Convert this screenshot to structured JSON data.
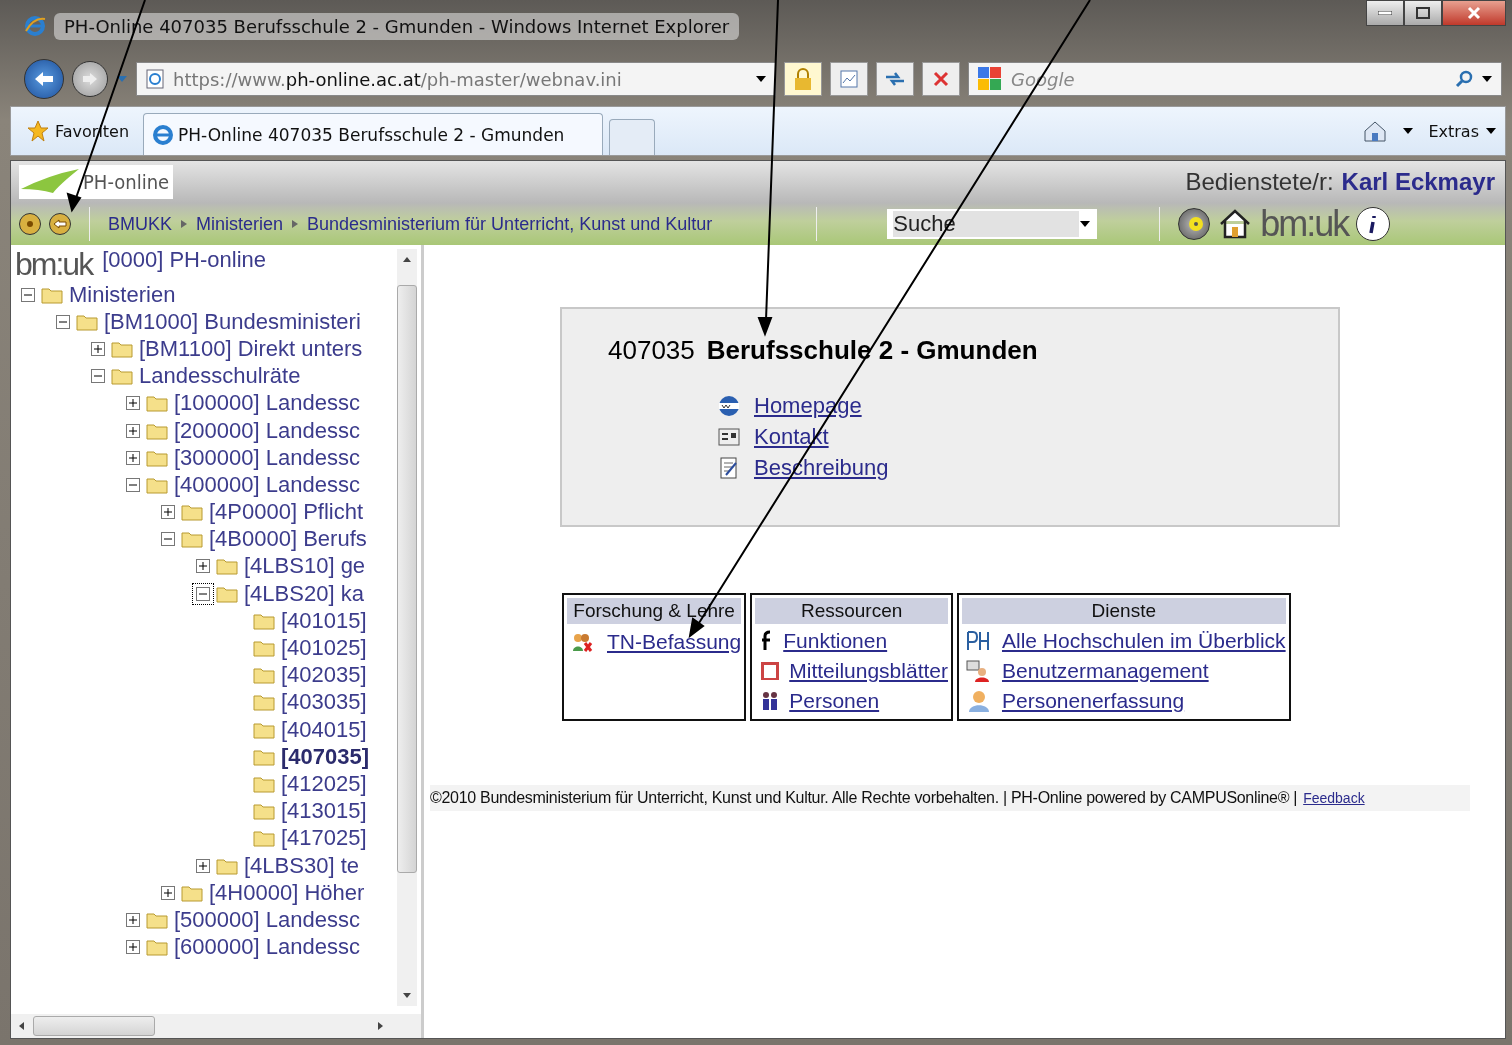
{
  "window": {
    "title": "PH-Online 407035 Berufsschule 2 - Gmunden - Windows Internet Explorer"
  },
  "address_bar": {
    "url_prefix": "https://www.",
    "url_domain": "ph-online.ac.at",
    "url_path": "/ph-master/webnav.ini",
    "search_placeholder": "Google"
  },
  "favorites": "Favoriten",
  "tabs": [
    {
      "label": "PH-Online 407035 Berufsschule 2 - Gmunden",
      "selected": true
    }
  ],
  "command_bar": {
    "extras": "Extras"
  },
  "header": {
    "logo": "PH-online",
    "user_label": "Bedienstete/r:",
    "user_name": "Karl Eckmayr",
    "breadcrumbs": [
      "BMUKK",
      "Ministerien",
      "Bundesministerium für Unterricht, Kunst und Kultur"
    ],
    "search_select": "Suche",
    "brand": "bm:uk"
  },
  "tree": {
    "logo": "bm:uk",
    "root": "[0000] PH-online",
    "items": [
      {
        "label": "Ministerien",
        "expanded": true,
        "children": [
          {
            "label": "[BM1000] Bundesministeri",
            "expanded": true,
            "children": [
              {
                "label": "[BM1100] Direkt unters",
                "expanded": false
              },
              {
                "label": "Landesschulräte",
                "expanded": true,
                "children": [
                  {
                    "label": "[100000] Landessc",
                    "expanded": false
                  },
                  {
                    "label": "[200000] Landessc",
                    "expanded": false
                  },
                  {
                    "label": "[300000] Landessc",
                    "expanded": false
                  },
                  {
                    "label": "[400000] Landessc",
                    "expanded": true,
                    "children": [
                      {
                        "label": "[4P0000] Pflicht",
                        "expanded": false
                      },
                      {
                        "label": "[4B0000] Berufs",
                        "expanded": true,
                        "children": [
                          {
                            "label": "[4LBS10] ge",
                            "expanded": false,
                            "focused": false
                          },
                          {
                            "label": "[4LBS20] ka",
                            "expanded": true,
                            "focused": true,
                            "children": [
                              {
                                "label": "[401015]",
                                "selected": false
                              },
                              {
                                "label": "[401025]",
                                "selected": false
                              },
                              {
                                "label": "[402035]",
                                "selected": false
                              },
                              {
                                "label": "[403035]",
                                "selected": false
                              },
                              {
                                "label": "[404015]",
                                "selected": false
                              },
                              {
                                "label": "[407035]",
                                "selected": true
                              },
                              {
                                "label": "[412025]",
                                "selected": false
                              },
                              {
                                "label": "[413015]",
                                "selected": false
                              },
                              {
                                "label": "[417025]",
                                "selected": false
                              }
                            ]
                          },
                          {
                            "label": "[4LBS30] te",
                            "expanded": false,
                            "focused": false
                          }
                        ]
                      },
                      {
                        "label": "[4H0000] Höher",
                        "expanded": false
                      }
                    ]
                  },
                  {
                    "label": "[500000] Landessc",
                    "expanded": false
                  },
                  {
                    "label": "[600000] Landessc",
                    "expanded": false
                  }
                ]
              }
            ]
          }
        ]
      }
    ]
  },
  "info_card": {
    "code": "407035",
    "name": "Berufsschule 2 - Gmunden",
    "links": [
      "Homepage",
      "Kontakt",
      "Beschreibung"
    ]
  },
  "boxes": [
    {
      "title": "Forschung & Lehre",
      "links": [
        "TN-Befassung"
      ]
    },
    {
      "title": "Ressourcen",
      "links": [
        "Funktionen",
        "Mitteilungsblätter",
        "Personen"
      ]
    },
    {
      "title": "Dienste",
      "links": [
        "Alle Hochschulen im Überblick",
        "Benutzermanagement",
        "Personenerfassung"
      ]
    }
  ],
  "footer": {
    "text": "©2010 Bundesministerium für Unterricht, Kunst und Kultur. Alle Rechte vorbehalten. | PH-Online powered by CAMPUSonline® |",
    "link": "Feedback"
  }
}
